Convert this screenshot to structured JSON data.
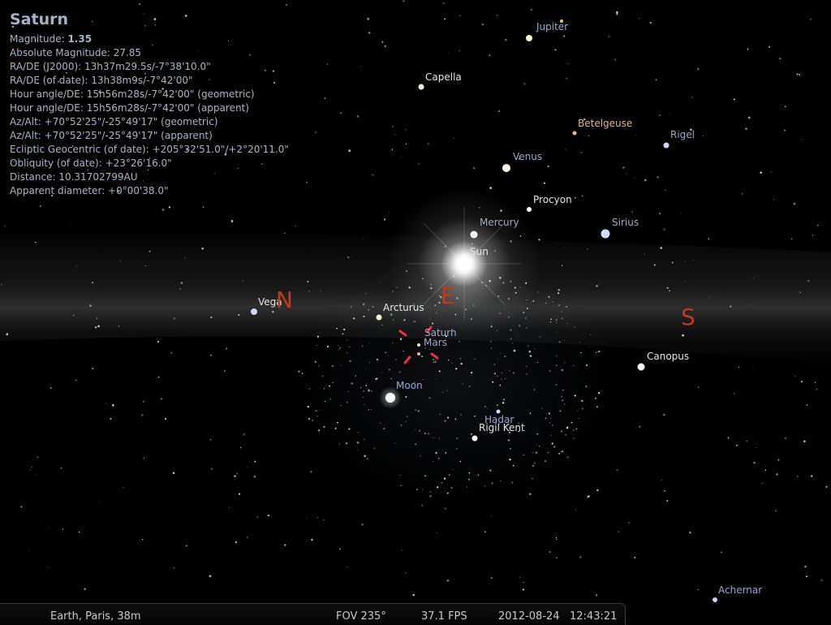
{
  "info": {
    "title": "Saturn",
    "magnitude_label": "Magnitude: ",
    "magnitude_value": "1.35",
    "lines": [
      "Absolute Magnitude: 27.85",
      "RA/DE (J2000): 13h37m29.5s/-7°38'10.0\"",
      "RA/DE (of date): 13h38m9s/-7°42'00\"",
      "Hour angle/DE: 15h56m28s/-7°42'00\" (geometric)",
      "Hour angle/DE: 15h56m28s/-7°42'00\" (apparent)",
      "Az/Alt: +70°52'25\"/-25°49'17\" (geometric)",
      "Az/Alt: +70°52'25\"/-25°49'17\" (apparent)",
      "Ecliptic Geocentric (of date): +205°32'51.0\"/+2°20'11.0\"",
      "Obliquity (of date): +23°26'16.0\"",
      "Distance: 10.31702799AU",
      "Apparent diameter: +0°00'38.0\""
    ]
  },
  "labels": {
    "jupiter": "Jupiter",
    "capella": "Capella",
    "betelgeuse": "Betelgeuse",
    "rigel": "Rigel",
    "venus": "Venus",
    "procyon": "Procyon",
    "mercury": "Mercury",
    "sirius": "Sirius",
    "sun": "Sun",
    "vega": "Vega",
    "arcturus": "Arcturus",
    "saturn": "Saturn",
    "mars": "Mars",
    "canopus": "Canopus",
    "moon": "Moon",
    "hadar": "Hadar",
    "rigil_kent": "Rigil Kent",
    "achernar": "Achernar"
  },
  "cardinals": {
    "north": "N",
    "east": "E",
    "south": "S"
  },
  "status": {
    "location": "Earth, Paris, 38m",
    "fov": "FOV 235°",
    "fps": "37.1 FPS",
    "date": "2012-08-24",
    "time": "12:43:21"
  },
  "colors": {
    "background": "#000000",
    "cardinal": "#c0391f",
    "selection_marker": "#e8323c",
    "info_text": "#a9b4c6"
  }
}
